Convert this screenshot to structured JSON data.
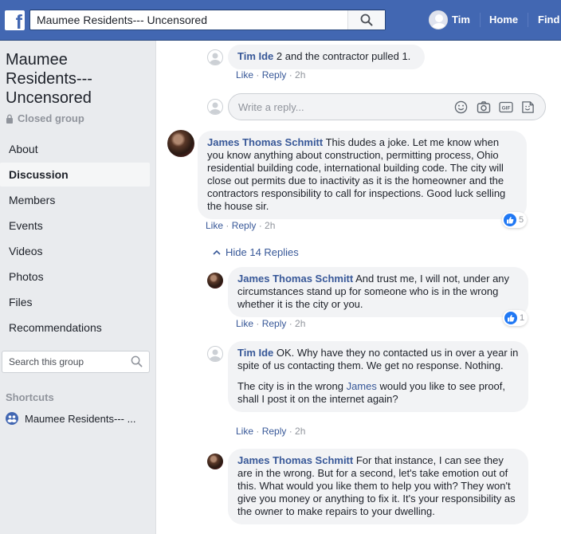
{
  "header": {
    "search_value": "Maumee Residents--- Uncensored",
    "user_name": "Tim",
    "nav_home": "Home",
    "nav_find": "Find"
  },
  "sidebar": {
    "group_title": "Maumee\nResidents---\nUncensored",
    "group_type": "Closed group",
    "nav": [
      "About",
      "Discussion",
      "Members",
      "Events",
      "Videos",
      "Photos",
      "Files",
      "Recommendations"
    ],
    "active_nav": "Discussion",
    "search_placeholder": "Search this group",
    "shortcuts_heading": "Shortcuts",
    "shortcut_item": "Maumee Residents--- ..."
  },
  "feed": {
    "reply_placeholder": "Write a reply...",
    "hide_replies": "Hide 14 Replies",
    "actions": {
      "like": "Like",
      "reply": "Reply"
    },
    "comments": [
      {
        "author": "Tim Ide",
        "text": " 2 and the contractor pulled 1.",
        "time": "2h"
      },
      {
        "author": "James Thomas Schmitt",
        "text": " This dudes a joke. Let me know when you know anything about construction, permitting process, Ohio residential building code, international building code. The city will close out permits due to inactivity as it is the homeowner and the contractors responsibility to call for inspections. Good luck selling the house sir.",
        "time": "2h",
        "likes": "5"
      },
      {
        "author": "James Thomas Schmitt",
        "text": " And trust me, I will not, under any circumstances stand up for someone who is in the wrong whether it is the city or you.",
        "time": "2h",
        "likes": "1"
      },
      {
        "author": "Tim Ide",
        "text": " OK. Why have they no contacted us in over a year in spite of us contacting them. We get no response. Nothing.",
        "text2_before": "The city is in the wrong ",
        "text2_mention": "James",
        "text2_after": " would you like to see proof, shall I post it on the internet again?",
        "time": "2h"
      },
      {
        "author": "James Thomas Schmitt",
        "text": " For that instance, I can see they are in the wrong. But for a second, let's take emotion out of this. What would you like them to help you with? They won't give you money or anything to fix it. It's your responsibility as the owner to make repairs to your dwelling."
      }
    ]
  },
  "colors": {
    "brand_blue": "#4267b2",
    "link_blue": "#385898",
    "bubble_bg": "#f2f3f5",
    "like_blue": "#2078f4"
  }
}
